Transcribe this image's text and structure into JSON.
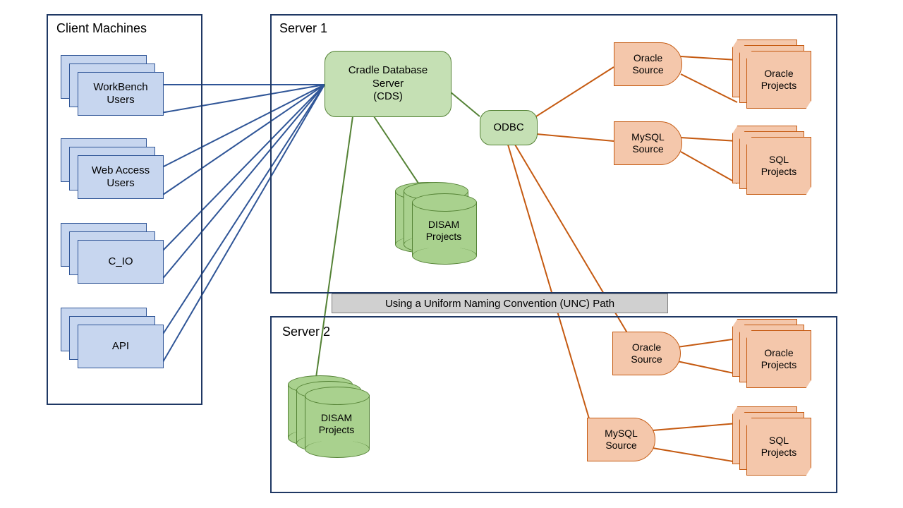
{
  "client_box_label": "Client Machines",
  "server1_label": "Server 1",
  "server2_label": "Server 2",
  "clients": {
    "workbench": "WorkBench Users",
    "webaccess": "Web Access Users",
    "cio": "C_IO",
    "api": "API"
  },
  "cds_label": "Cradle Database\nServer\n(CDS)",
  "odbc_label": "ODBC",
  "disam_label": "DISAM\nProjects",
  "oracle_source": "Oracle\nSource",
  "mysql_source": "MySQL\nSource",
  "oracle_projects": "Oracle\nProjects",
  "sql_projects": "SQL\nProjects",
  "banner": "Using a Uniform Naming Convention (UNC) Path"
}
